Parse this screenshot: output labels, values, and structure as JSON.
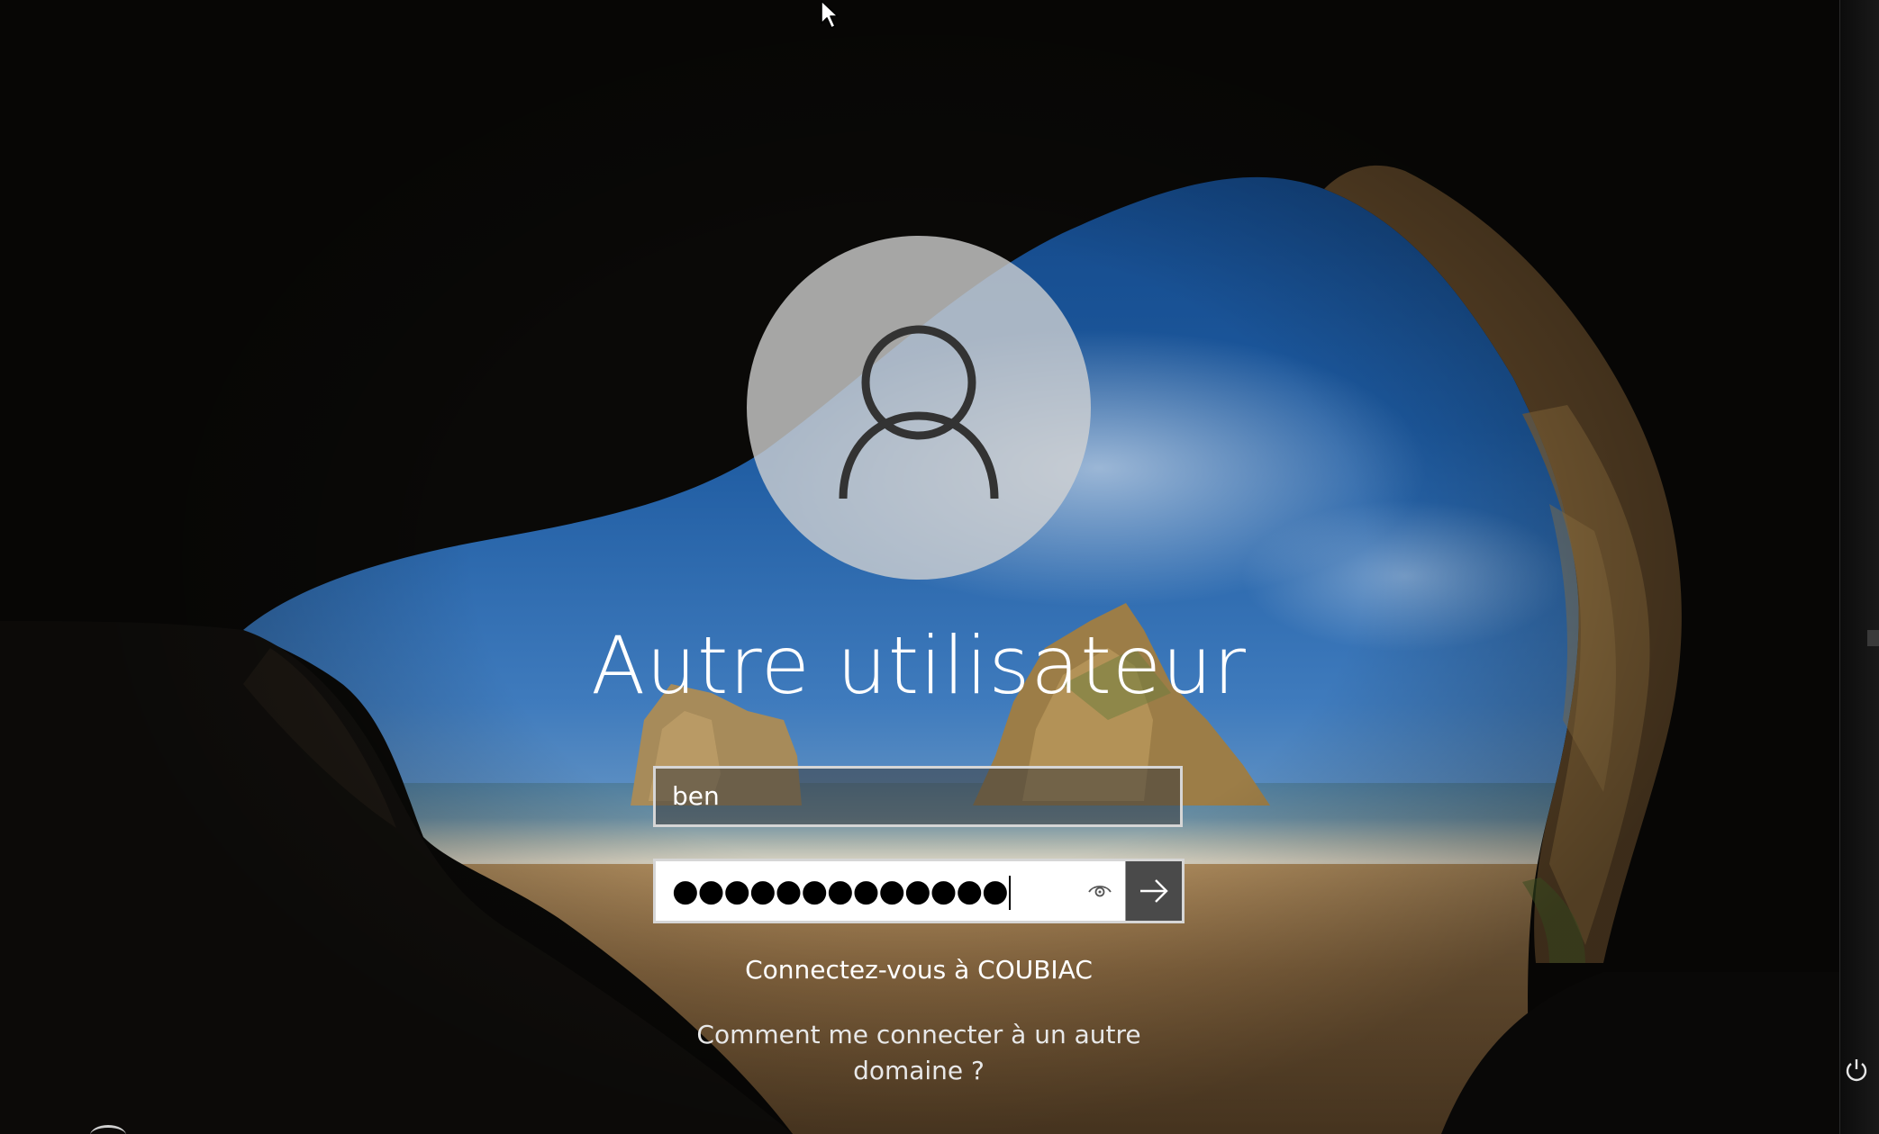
{
  "login": {
    "title": "Autre utilisateur",
    "username_value": "ben",
    "password_mask": "●●●●●●●●●●●●●",
    "signin_to": "Connectez-vous à COUBIAC",
    "other_domain_link": "Comment me connecter à un autre domaine ?"
  },
  "icons": {
    "avatar": "user-silhouette-icon",
    "reveal": "eye-icon",
    "submit": "arrow-right-icon",
    "power": "power-icon",
    "cursor": "mouse-cursor-icon"
  },
  "colors": {
    "text": "#ffffff",
    "field_border": "#d6d6d6",
    "submit_bg": "#4a4a4a",
    "avatar_bg": "#d2d2d2"
  }
}
